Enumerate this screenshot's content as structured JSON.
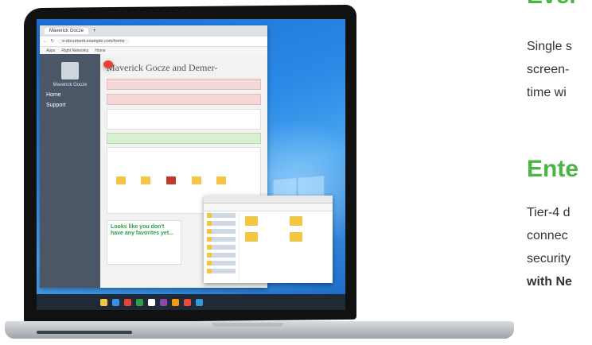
{
  "heading_top": "Ever",
  "paragraph1": [
    "Single s",
    "screen-",
    "time wi"
  ],
  "heading_mid": "Ente",
  "paragraph2": [
    "Tier-4 d",
    "connec",
    "security",
    "with Ne"
  ],
  "screen": {
    "chrome_tab": "Maverick Gocze",
    "chrome_url": "e-document.example.com/home",
    "bookmarks": [
      "Apps",
      "Right Networks",
      "Home"
    ],
    "app_title": "Maverick Gocze and Demer-",
    "sidebar_user": "Maverick Gocze",
    "sidebar_items": [
      "Home",
      "Support"
    ],
    "favorites_text": "Looks like you don't have any favorites yet..."
  }
}
